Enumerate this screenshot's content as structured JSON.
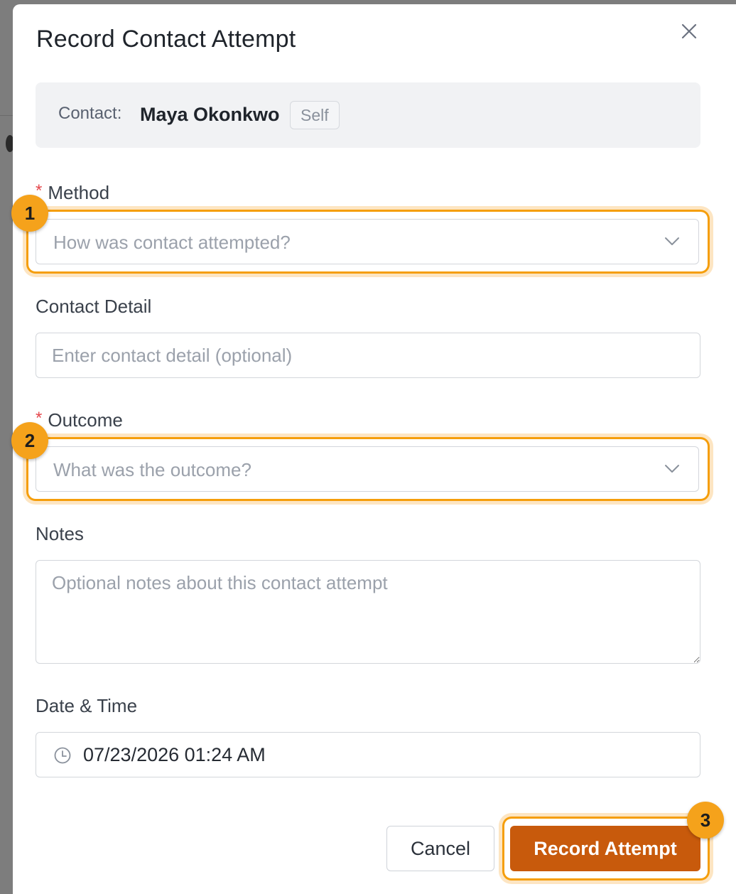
{
  "modal": {
    "title": "Record Contact Attempt",
    "close_icon": "close-icon"
  },
  "contact": {
    "label": "Contact:",
    "name": "Maya Okonkwo",
    "relation_badge": "Self"
  },
  "fields": {
    "method": {
      "label": "Method",
      "required_mark": "*",
      "placeholder": "How was contact attempted?"
    },
    "contact_detail": {
      "label": "Contact Detail",
      "placeholder": "Enter contact detail (optional)"
    },
    "outcome": {
      "label": "Outcome",
      "required_mark": "*",
      "placeholder": "What was the outcome?"
    },
    "notes": {
      "label": "Notes",
      "placeholder": "Optional notes about this contact attempt"
    },
    "datetime": {
      "label": "Date & Time",
      "value": "07/23/2026 01:24 AM",
      "icon": "clock-icon"
    }
  },
  "actions": {
    "cancel_label": "Cancel",
    "submit_label": "Record Attempt"
  },
  "markers": [
    "1",
    "2",
    "3"
  ],
  "colors": {
    "primary": "#c85a0c",
    "highlight": "#f59e0b",
    "marker": "#f5a21b",
    "required": "#e5484d"
  }
}
